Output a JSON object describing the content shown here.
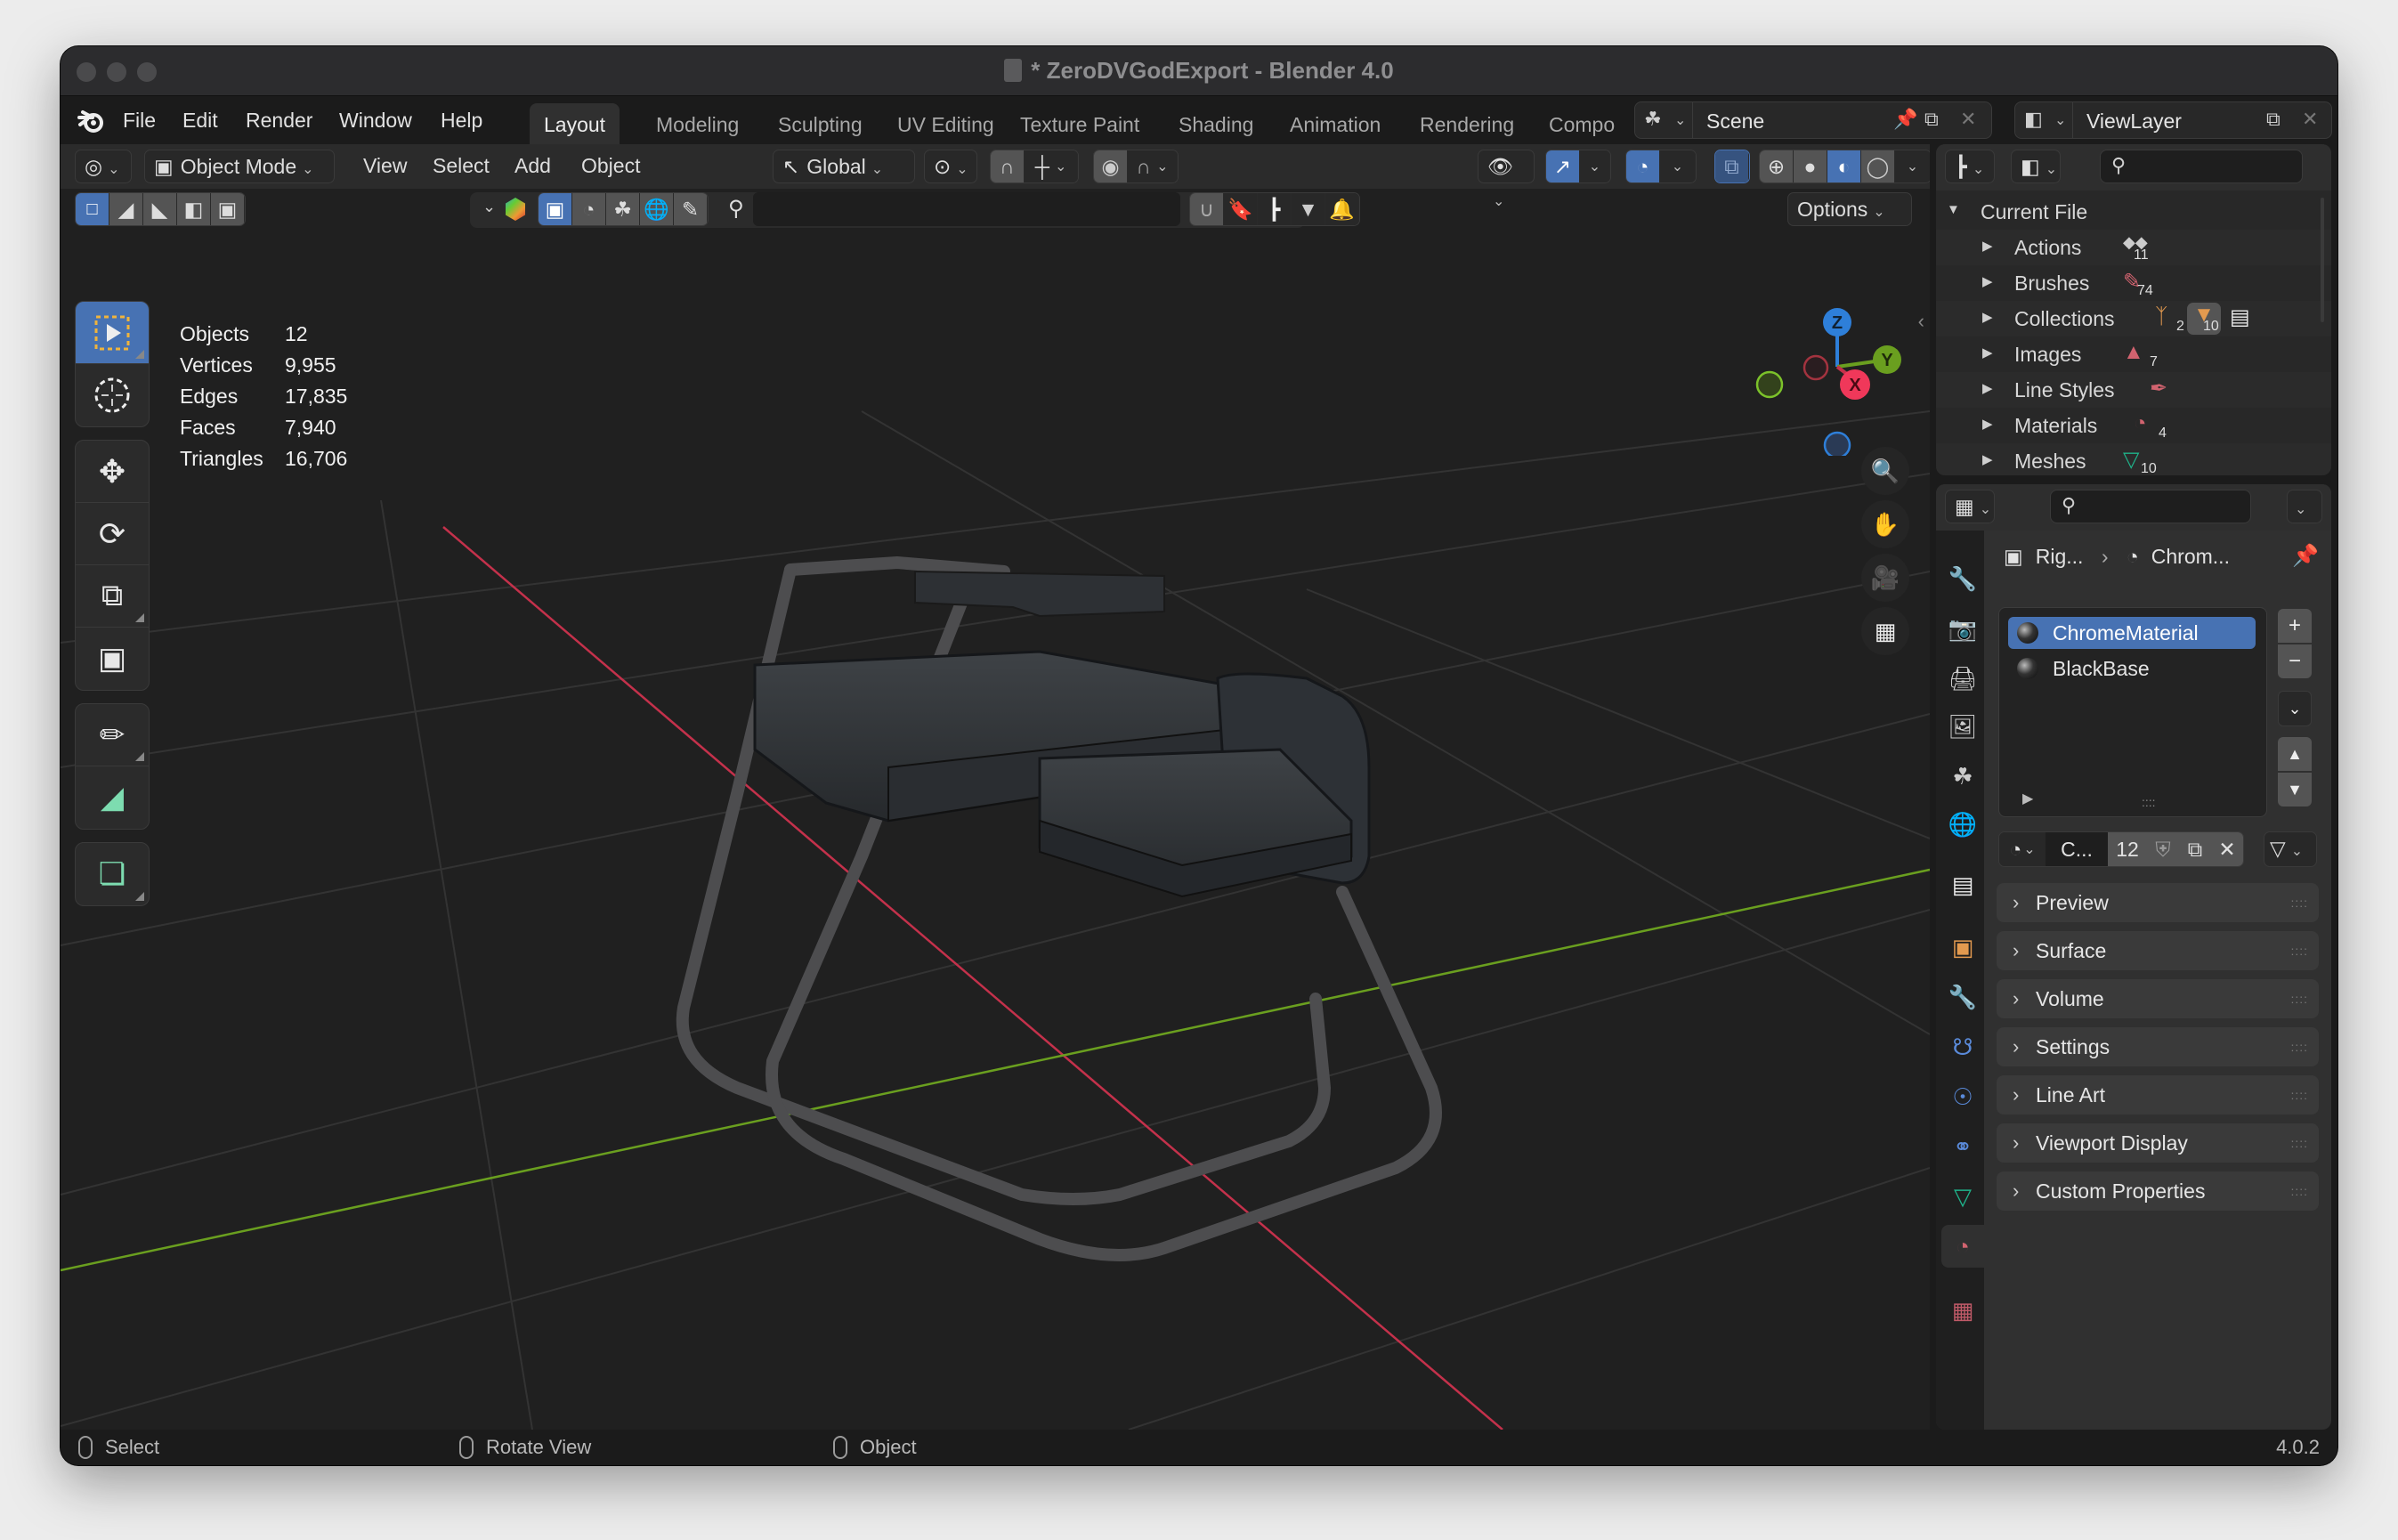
{
  "window": {
    "title": "* ZeroDVGodExport - Blender 4.0"
  },
  "menubar": {
    "logo": "blender-logo-icon",
    "menus": [
      "File",
      "Edit",
      "Render",
      "Window",
      "Help"
    ],
    "workspaces": [
      {
        "label": "Layout",
        "active": true
      },
      {
        "label": "Modeling",
        "active": false
      },
      {
        "label": "Sculpting",
        "active": false
      },
      {
        "label": "UV Editing",
        "active": false
      },
      {
        "label": "Texture Paint",
        "active": false
      },
      {
        "label": "Shading",
        "active": false
      },
      {
        "label": "Animation",
        "active": false
      },
      {
        "label": "Rendering",
        "active": false
      },
      {
        "label": "Compo",
        "active": false
      }
    ],
    "scene": {
      "label": "Scene"
    },
    "view_layer": {
      "label": "ViewLayer"
    }
  },
  "viewport_header": {
    "mode": "Object Mode",
    "menus": [
      "View",
      "Select",
      "Add",
      "Object"
    ],
    "transform_orientation": "Global",
    "options_label": "Options"
  },
  "stats": [
    {
      "label": "Objects",
      "value": "12"
    },
    {
      "label": "Vertices",
      "value": "9,955"
    },
    {
      "label": "Edges",
      "value": "17,835"
    },
    {
      "label": "Faces",
      "value": "7,940"
    },
    {
      "label": "Triangles",
      "value": "16,706"
    }
  ],
  "gizmo": {
    "axes": {
      "x": "X",
      "y": "Y",
      "z": "Z"
    },
    "colors": {
      "x": "#f0385a",
      "y": "#6a9f1f",
      "z": "#2e7fd9"
    }
  },
  "tools": [
    {
      "name": "select-box",
      "active": true
    },
    {
      "name": "cursor",
      "active": false
    },
    {
      "name": "move",
      "active": false
    },
    {
      "name": "rotate",
      "active": false
    },
    {
      "name": "scale",
      "active": false
    },
    {
      "name": "transform",
      "active": false
    },
    {
      "name": "annotate",
      "active": false
    },
    {
      "name": "measure",
      "active": false
    },
    {
      "name": "add-cube",
      "active": false
    }
  ],
  "outliner": {
    "root": "Current File",
    "items": [
      {
        "label": "Actions",
        "count": "11",
        "icon": "action-icon",
        "color": "#cccccc"
      },
      {
        "label": "Brushes",
        "count": "74",
        "icon": "brush-icon",
        "color": "#d1636f"
      },
      {
        "label": "Collections",
        "count": "2",
        "count2": "10",
        "icon": "collection-icon",
        "color": "#e39a4f"
      },
      {
        "label": "Images",
        "count": "7",
        "icon": "image-icon",
        "color": "#d1636f"
      },
      {
        "label": "Line Styles",
        "count": "",
        "icon": "linestyle-icon",
        "color": "#d1636f"
      },
      {
        "label": "Materials",
        "count": "4",
        "icon": "material-icon",
        "color": "#d1636f"
      },
      {
        "label": "Meshes",
        "count": "10",
        "icon": "mesh-icon",
        "color": "#1fb38a"
      }
    ]
  },
  "properties": {
    "breadcrumb": {
      "object": "Rig...",
      "material": "Chrom..."
    },
    "material_slots": [
      {
        "label": "ChromeMaterial",
        "selected": true
      },
      {
        "label": "BlackBase",
        "selected": false
      }
    ],
    "datablock": {
      "name": "C...",
      "users": "12"
    },
    "panels": [
      "Preview",
      "Surface",
      "Volume",
      "Settings",
      "Line Art",
      "Viewport Display",
      "Custom Properties"
    ]
  },
  "statusbar": {
    "items": [
      "Select",
      "Rotate View",
      "Object"
    ],
    "version": "4.0.2"
  },
  "colors": {
    "accent": "#4772b3",
    "viewport_bg": "#202020",
    "x_axis_line": "#c4314b",
    "y_axis_line": "#6a9f1f"
  }
}
